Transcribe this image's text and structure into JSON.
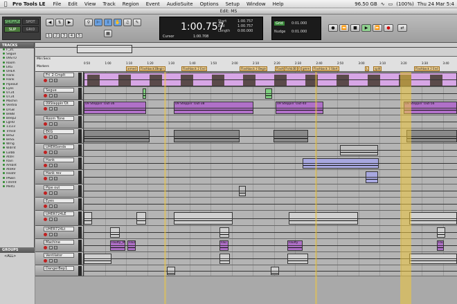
{
  "menubar": {
    "app": "Pro Tools LE",
    "items": [
      "File",
      "Edit",
      "View",
      "Track",
      "Region",
      "Event",
      "AudioSuite",
      "Options",
      "Setup",
      "Window",
      "Help"
    ],
    "disk": "96.50 GB",
    "battery": "(100%)",
    "clock": "Thu 24 Mar  5:4"
  },
  "window": {
    "title": "Edit: MS"
  },
  "toolbar": {
    "modes": [
      "SHUFFLE",
      "SPOT",
      "SLIP",
      "GRID"
    ],
    "zoom_presets": [
      "1",
      "2",
      "3",
      "4",
      "5"
    ],
    "main_counter": "1:00.757",
    "cursor_label": "Cursor",
    "cursor_value": "1:00.708",
    "start_label": "Start",
    "start_value": "1:00.757",
    "end_label": "End",
    "end_value": "1:00.757",
    "length_label": "Length",
    "length_value": "0:00.000",
    "grid_label": "Grid",
    "grid_value": "0:01.000",
    "nudge_label": "Nudge",
    "nudge_value": "0:01.000"
  },
  "panels": {
    "tracks_title": "TRACKS",
    "groups_title": "GROUPS",
    "group_item": "<ALL>"
  },
  "tracklist": [
    "F_2C",
    "Segue",
    "09STO",
    "Room",
    "EKG",
    "UHER",
    "Hank",
    "Hank",
    "Pipeout",
    "Eyes",
    "UT24",
    "UT24",
    "Machin",
    "Ventila",
    "DrGB",
    "BeBB",
    "Beep2",
    "LgHO",
    "11/23",
    "Trms0",
    "BeS2",
    "BeSS",
    "Wrng",
    "Wdrnt",
    "Lulbb",
    "AtdFl",
    "Rain",
    "Ambnt",
    "AtdRV",
    "HeatV",
    "PAwin",
    "FdVmt",
    "Melt1"
  ],
  "rulers": {
    "minsecs": "Min:Secs",
    "markers": "Markers",
    "ticks": [
      "0:50",
      "1:00",
      "1:10",
      "1:20",
      "1:30",
      "1:40",
      "1:50",
      "2:00",
      "2:10",
      "2:20",
      "2:30",
      "2:40",
      "2:50",
      "3:00",
      "3:10",
      "3:20",
      "3:30",
      "3:40"
    ],
    "marker_names": [
      "armed",
      "Flashback1Begin",
      "Flashback 2 End",
      "Flashback 2 Begin",
      "Flashback 3 End",
      "Flshb3B",
      "gmm",
      "Flashback 3 Start",
      "L",
      "split",
      "Flashback 2 End"
    ]
  },
  "tracks": [
    {
      "name": "Fri_2-Cmplt",
      "kind": "video"
    },
    {
      "name": "Segue",
      "kind": "audio"
    },
    {
      "name": "09Steppin'Ot",
      "kind": "audio"
    },
    {
      "name": "Room Tone",
      "kind": "audio"
    },
    {
      "name": "EKG",
      "kind": "audio"
    },
    {
      "name": "UHERSonds",
      "kind": "audio"
    },
    {
      "name": "Hank",
      "kind": "audio"
    },
    {
      "name": "Hank rev",
      "kind": "audio"
    },
    {
      "name": "Pipe out",
      "kind": "audio"
    },
    {
      "name": "Eyes",
      "kind": "audio"
    },
    {
      "name": "UHER724LE",
      "kind": "audio"
    },
    {
      "name": "UHER724Lt",
      "kind": "audio"
    },
    {
      "name": "Machine",
      "kind": "audio"
    },
    {
      "name": "Ventilator",
      "kind": "audio"
    },
    {
      "name": "DangerBep1",
      "kind": "audio"
    }
  ],
  "clips": {
    "steppin": [
      "09 Steppin' Out-36",
      "09 Steppin' Out-38",
      "09 Steppin' Out-40",
      "09 Steppin' Out-56"
    ],
    "machine": [
      "Faulty_M",
      "Faul",
      "Fau",
      "Faulty",
      "Fau"
    ]
  },
  "colors": {
    "video": "#d7a6e6",
    "purple": "#b070c8",
    "audio": "#c8c8c8",
    "selection": "#f0c83c"
  }
}
